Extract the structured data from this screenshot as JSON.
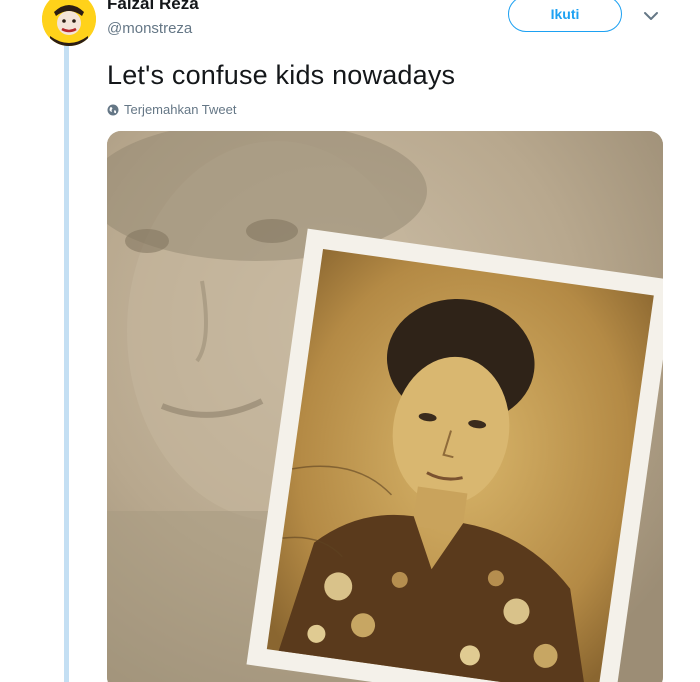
{
  "tweet": {
    "display_name": "Faizal Reza",
    "handle": "@monstreza",
    "follow_label": "Ikuti",
    "text": "Let's confuse kids nowadays",
    "translate_label": "Terjemahkan Tweet"
  },
  "icons": {
    "globe": "globe-icon",
    "chevron": "chevron-down-icon"
  },
  "colors": {
    "accent": "#1da1f2",
    "secondary_text": "#657786",
    "thread_line": "#c4dff3",
    "avatar_bg": "#ffd21a"
  }
}
